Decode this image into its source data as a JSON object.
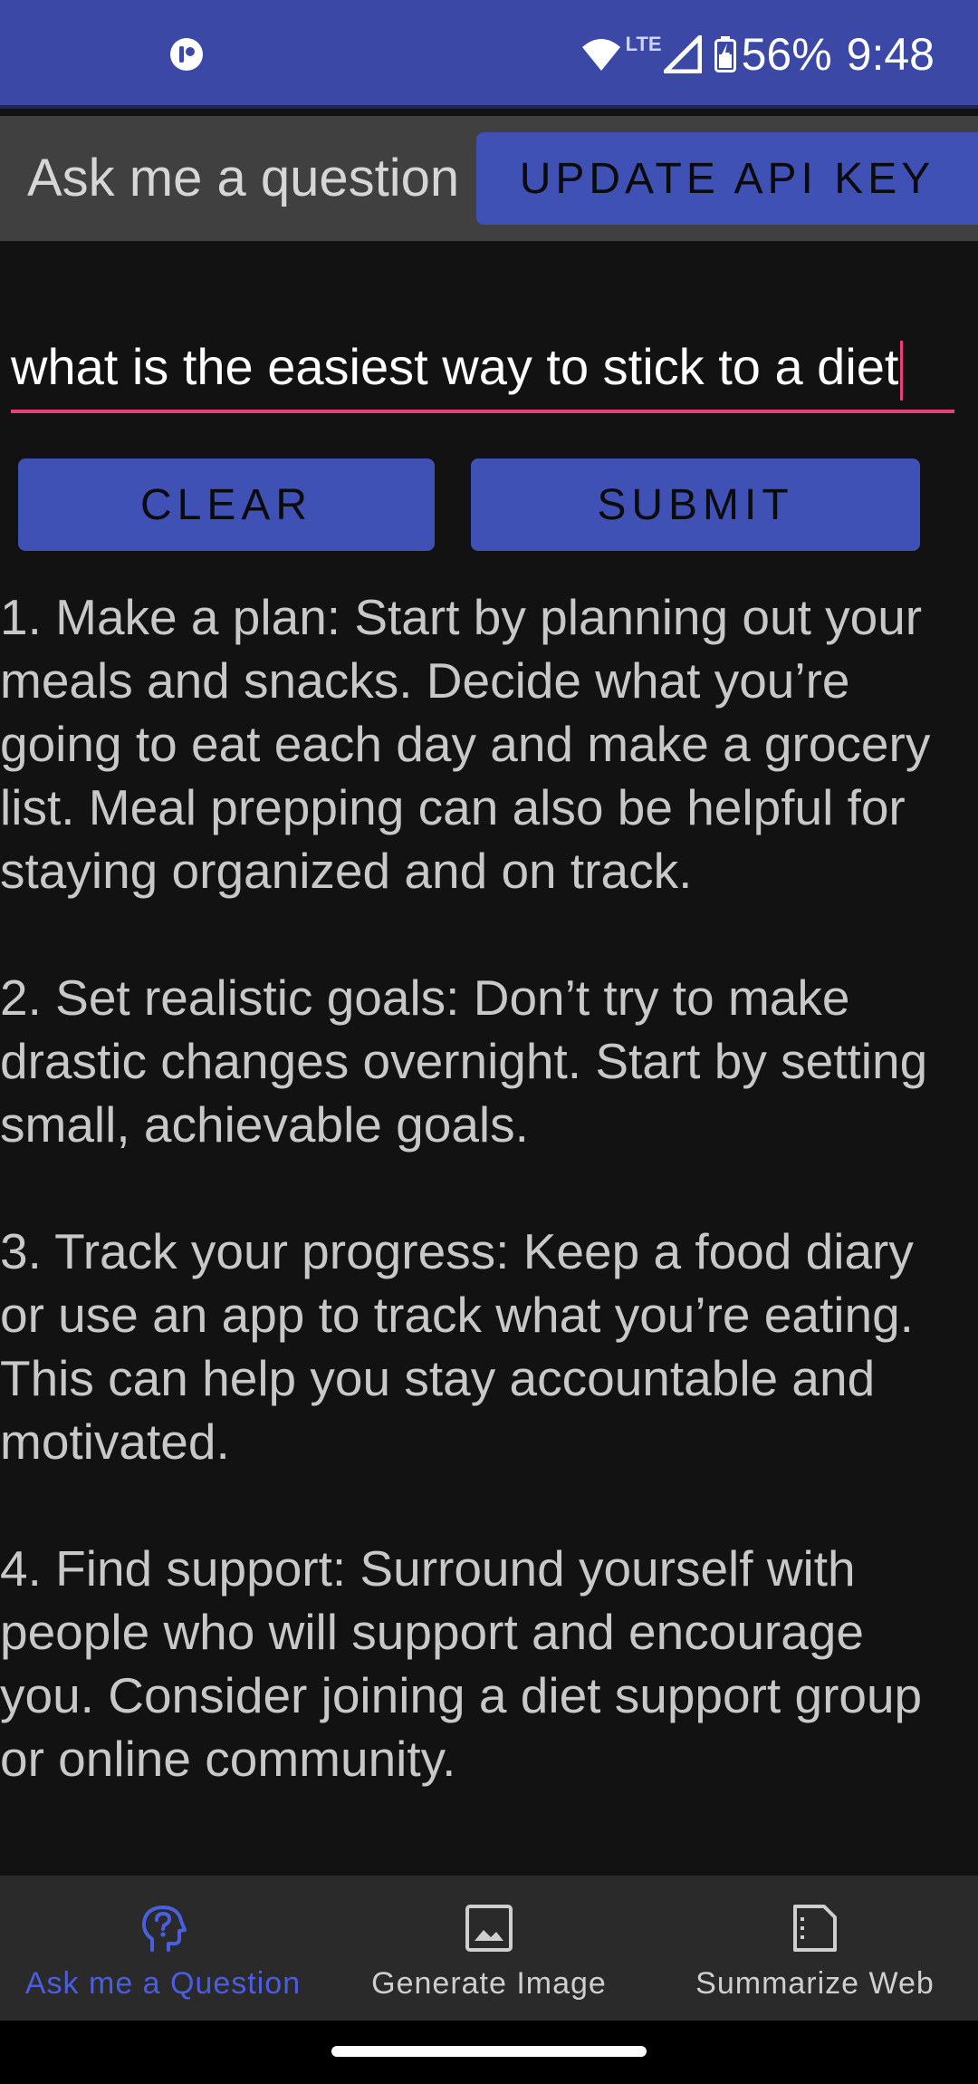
{
  "status_bar": {
    "network_type": "LTE",
    "battery_percent": "56%",
    "time": "9:48",
    "icons": [
      "app-notification-icon",
      "wifi-icon",
      "signal-icon",
      "battery-charging-icon"
    ]
  },
  "toolbar": {
    "title": "Ask me a question",
    "update_api_key_label": "UPDATE API KEY"
  },
  "question": {
    "value": "what is the easiest way to stick to a diet"
  },
  "actions": {
    "clear_label": "CLEAR",
    "submit_label": "SUBMIT"
  },
  "answer": {
    "paragraphs": [
      "1. Make a plan: Start by planning out your meals and snacks. Decide what you’re going to eat each day and make a grocery list. Meal prepping can also be helpful for staying organized and on track.",
      "2. Set realistic goals: Don’t try to make drastic changes overnight. Start by setting small, achievable goals.",
      "3. Track your progress: Keep a food diary or use an app to track what you’re eating. This can help you stay accountable and motivated.",
      "4. Find support: Surround yourself with people who will support and encourage you. Consider joining a diet support group or online community."
    ]
  },
  "bottom_nav": {
    "items": [
      {
        "label": "Ask me a Question",
        "icon": "question-head-icon",
        "active": true
      },
      {
        "label": "Generate Image",
        "icon": "image-icon",
        "active": false
      },
      {
        "label": "Summarize Web",
        "icon": "document-icon",
        "active": false
      }
    ]
  },
  "colors": {
    "primary": "#3f51b5",
    "status_bar": "#3b48a6",
    "accent": "#e8407a",
    "active_nav": "#4a5ee0",
    "background": "#121212"
  }
}
